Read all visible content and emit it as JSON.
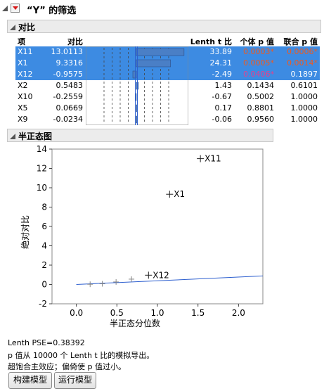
{
  "header": {
    "title": "“Y” 的筛选"
  },
  "contrasts": {
    "title": "对比",
    "columns": {
      "term": "项",
      "contrast": "对比",
      "lenth": "Lenth t 比",
      "indiv_p": "个体 p 值",
      "simul_p": "联合 p 值"
    },
    "rows": [
      {
        "term": "X11",
        "contrast": "13.0113",
        "lenth": "33.89",
        "indiv_p": "0.0003*",
        "simul_p": "0.0006*",
        "selected": true,
        "pcolor": "red",
        "scolor": "red",
        "bar": 13.0113
      },
      {
        "term": "X1",
        "contrast": "9.3316",
        "lenth": "24.31",
        "indiv_p": "0.0005*",
        "simul_p": "0.0014*",
        "selected": true,
        "pcolor": "red",
        "scolor": "red",
        "bar": 9.3316
      },
      {
        "term": "X12",
        "contrast": "-0.9575",
        "lenth": "-2.49",
        "indiv_p": "0.0406*",
        "simul_p": "0.1897",
        "selected": true,
        "pcolor": "magenta",
        "scolor": "none",
        "bar": -0.9575
      },
      {
        "term": "X2",
        "contrast": "0.5483",
        "lenth": "1.43",
        "indiv_p": "0.1434",
        "simul_p": "0.6101",
        "selected": false,
        "bar": 0.5483
      },
      {
        "term": "X10",
        "contrast": "-0.2559",
        "lenth": "-0.67",
        "indiv_p": "0.5002",
        "simul_p": "1.0000",
        "selected": false,
        "bar": -0.2559
      },
      {
        "term": "X5",
        "contrast": "0.0669",
        "lenth": "0.17",
        "indiv_p": "0.8801",
        "simul_p": "1.0000",
        "selected": false,
        "bar": 0.0669
      },
      {
        "term": "X9",
        "contrast": "-0.0234",
        "lenth": "-0.06",
        "indiv_p": "0.9560",
        "simul_p": "1.0000",
        "selected": false,
        "bar": -0.0234
      }
    ]
  },
  "half_normal": {
    "title": "半正态图",
    "xlabel": "半正态分位数",
    "ylabel": "绝对对比",
    "xlim": [
      -0.3,
      2.3
    ],
    "ylim": [
      -2,
      14
    ],
    "xticks": [
      "0.0",
      "0.5",
      "1.0",
      "1.5",
      "2.0"
    ],
    "yticks": [
      "-2",
      "0",
      "2",
      "4",
      "6",
      "8",
      "10",
      "12",
      "14"
    ],
    "points": [
      {
        "x": 0.17,
        "y": 0.02,
        "label": ""
      },
      {
        "x": 0.32,
        "y": 0.07,
        "label": ""
      },
      {
        "x": 0.49,
        "y": 0.26,
        "label": ""
      },
      {
        "x": 0.68,
        "y": 0.55,
        "label": ""
      },
      {
        "x": 0.89,
        "y": 0.96,
        "label": "X12"
      },
      {
        "x": 1.15,
        "y": 9.33,
        "label": "X1"
      },
      {
        "x": 1.53,
        "y": 13.01,
        "label": "X11"
      }
    ],
    "line": {
      "x": [
        0,
        2.3
      ],
      "y": [
        0,
        0.88
      ]
    }
  },
  "footer": {
    "pse": "Lenth PSE=0.38392",
    "note1": "p 值从 10000 个 Lenth t 比的模拟导出。",
    "note2": "超饱合主效应；偏倚使 p 值过小。"
  },
  "buttons": {
    "make_model": "构建模型",
    "run_model": "运行模型"
  },
  "colors": {
    "selection": "#3d8be2",
    "bar_fill": "#4a7fc6",
    "fit_line": "#2d5fcf",
    "sig_red": "#f05a1e",
    "sig_magenta": "#e6408c"
  }
}
